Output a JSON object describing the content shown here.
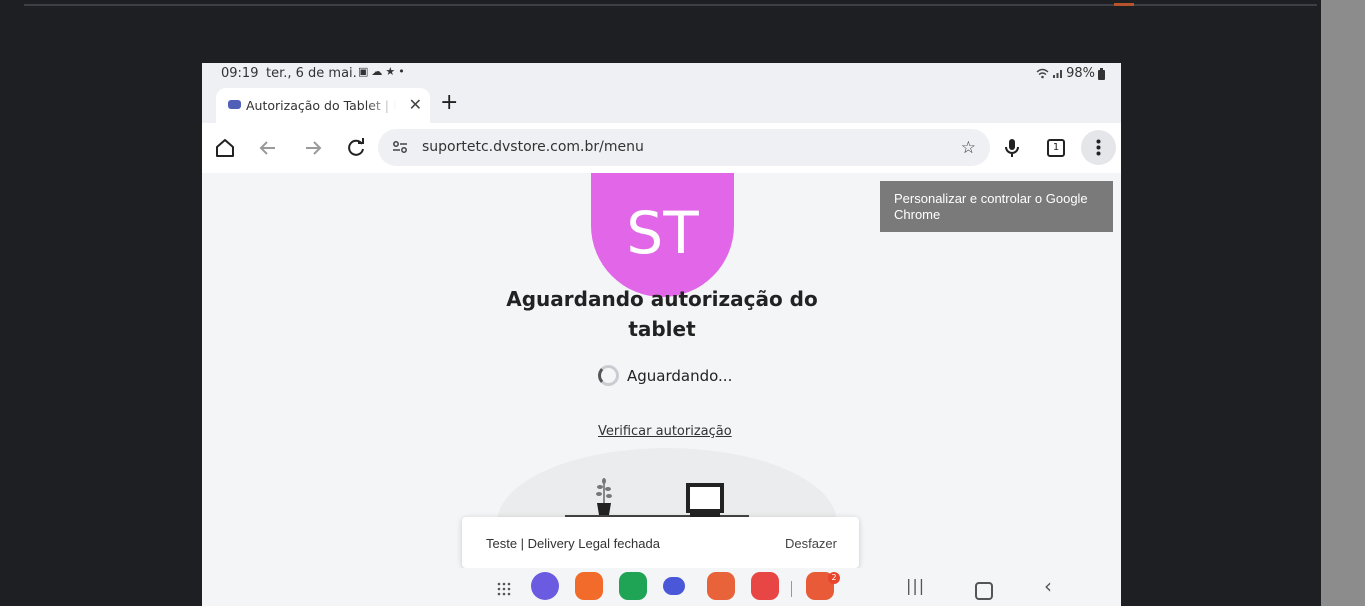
{
  "status_bar": {
    "time": "09:19",
    "date": "ter., 6 de mai.",
    "notification_icons": "▣☁★•",
    "battery": "98%"
  },
  "browser": {
    "tab_title": "Autorização do Tablet | Deli",
    "url": "suportetc.dvstore.com.br/menu",
    "tab_count": "1",
    "menu_tooltip": "Personalizar e controlar o Google Chrome"
  },
  "page": {
    "avatar_initials": "ST",
    "avatar_color": "#e266e8",
    "heading": "Aguardando autorização do tablet",
    "status_text": "Aguardando...",
    "verify_link": "Verificar autorização"
  },
  "toast": {
    "message": "Teste | Delivery Legal fechada",
    "action": "Desfazer"
  },
  "dock": {
    "apps": [
      {
        "name": "internet",
        "color": "#6a5be0"
      },
      {
        "name": "gallery",
        "color": "#f26b2a"
      },
      {
        "name": "phone",
        "color": "#1fa354"
      },
      {
        "name": "messages",
        "color": "#4a57d8"
      },
      {
        "name": "contacts",
        "color": "#e8623a"
      },
      {
        "name": "screen-recorder",
        "color": "#e84545"
      },
      {
        "name": "app-with-badge",
        "color": "#e85a38"
      }
    ],
    "badge_count": "2"
  }
}
